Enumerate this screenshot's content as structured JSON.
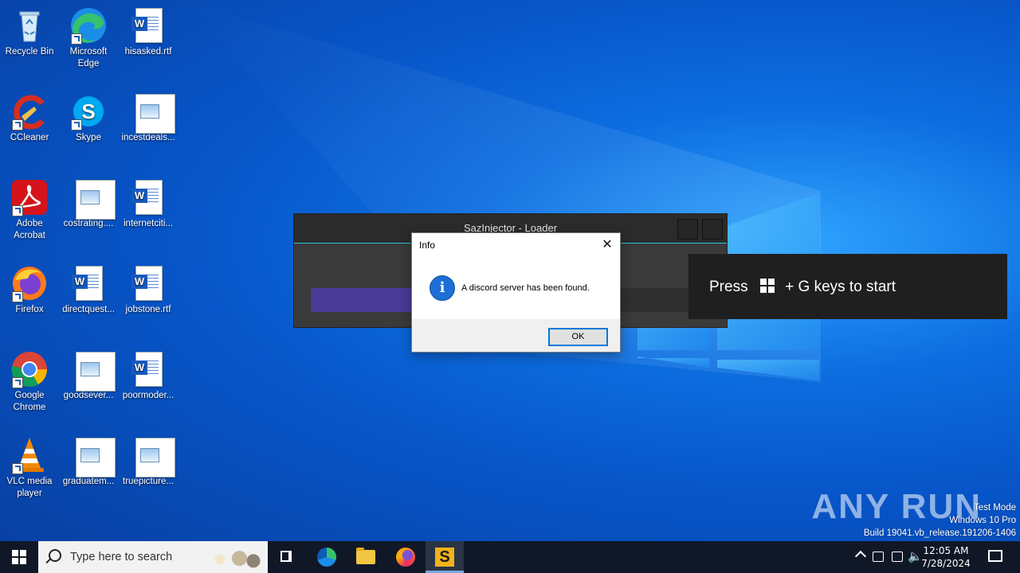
{
  "desktop": {
    "icons": [
      {
        "label": "Recycle Bin"
      },
      {
        "label": "Microsoft Edge"
      },
      {
        "label": "hisasked.rtf"
      },
      {
        "label": "CCleaner"
      },
      {
        "label": "Skype"
      },
      {
        "label": "incestdeals..."
      },
      {
        "label": "Adobe Acrobat"
      },
      {
        "label": "costrating...."
      },
      {
        "label": "internetciti..."
      },
      {
        "label": "Firefox"
      },
      {
        "label": "directquest..."
      },
      {
        "label": "jobstone.rtf"
      },
      {
        "label": "Google Chrome"
      },
      {
        "label": "goodsever..."
      },
      {
        "label": "poormoder..."
      },
      {
        "label": "VLC media player"
      },
      {
        "label": "graduatem..."
      },
      {
        "label": "truepicture..."
      }
    ]
  },
  "loader_window": {
    "title": "SazInjector - Loader",
    "progress_fraction": 0.26
  },
  "dialog": {
    "title": "Info",
    "message": "A discord server has been found.",
    "ok_label": "OK",
    "close_glyph": "✕",
    "icon": "info-icon"
  },
  "gamebar": {
    "text_before": "Press",
    "text_after": "+ G keys to start"
  },
  "watermark": {
    "brand": "ANY RUN",
    "line1": "Test Mode",
    "line2": "Windows 10 Pro",
    "line3": "Build 19041.vb_release.191206-1406"
  },
  "taskbar": {
    "search_placeholder": "Type here to search",
    "time": "12:05 AM",
    "date": "7/28/2024",
    "pinned": [
      "task-view",
      "microsoft-edge",
      "file-explorer",
      "firefox",
      "sazinjector"
    ]
  }
}
